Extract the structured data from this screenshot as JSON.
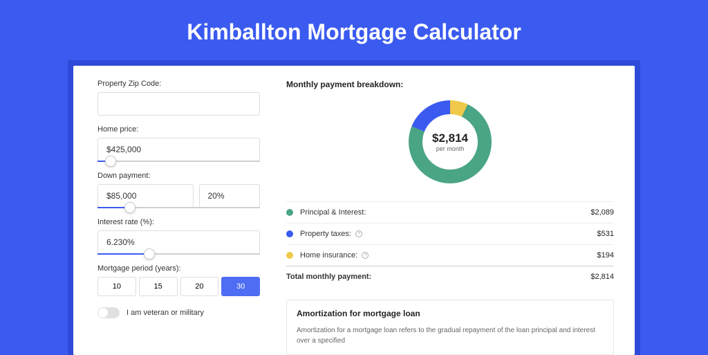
{
  "title": "Kimballton Mortgage Calculator",
  "form": {
    "zip_label": "Property Zip Code:",
    "zip_value": "",
    "home_price_label": "Home price:",
    "home_price_value": "$425,000",
    "home_price_slider_pct": 8,
    "down_payment_label": "Down payment:",
    "down_payment_value": "$85,000",
    "down_payment_pct_value": "20%",
    "down_payment_slider_pct": 20,
    "interest_label": "Interest rate (%):",
    "interest_value": "6.230%",
    "interest_slider_pct": 32,
    "period_label": "Mortgage period (years):",
    "period_options": [
      "10",
      "15",
      "20",
      "30"
    ],
    "period_selected": "30",
    "veteran_label": "I am veteran or military"
  },
  "breakdown": {
    "title": "Monthly payment breakdown:",
    "donut_value": "$2,814",
    "donut_sub": "per month",
    "items": [
      {
        "color": "green",
        "label": "Principal & Interest:",
        "info": false,
        "amount": "$2,089"
      },
      {
        "color": "blue",
        "label": "Property taxes:",
        "info": true,
        "amount": "$531"
      },
      {
        "color": "yellow",
        "label": "Home insurance:",
        "info": true,
        "amount": "$194"
      }
    ],
    "total_label": "Total monthly payment:",
    "total_amount": "$2,814"
  },
  "amort": {
    "title": "Amortization for mortgage loan",
    "text": "Amortization for a mortgage loan refers to the gradual repayment of the loan principal and interest over a specified"
  },
  "chart_data": {
    "type": "pie",
    "title": "Monthly payment breakdown",
    "series": [
      {
        "name": "Principal & Interest",
        "value": 2089,
        "color": "#4aa584"
      },
      {
        "name": "Property taxes",
        "value": 531,
        "color": "#3b5bf0"
      },
      {
        "name": "Home insurance",
        "value": 194,
        "color": "#f0c94a"
      }
    ],
    "center_label": "$2,814 per month"
  }
}
